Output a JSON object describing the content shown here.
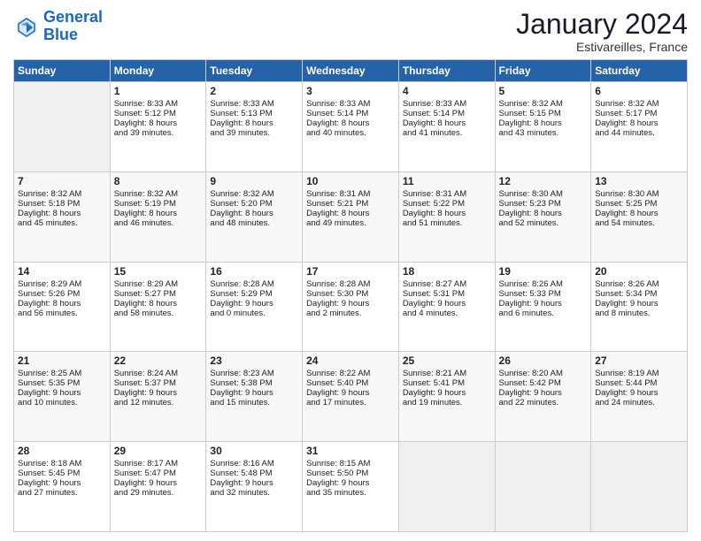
{
  "logo": {
    "line1": "General",
    "line2": "Blue"
  },
  "header": {
    "month": "January 2024",
    "location": "Estivareilles, France"
  },
  "columns": [
    "Sunday",
    "Monday",
    "Tuesday",
    "Wednesday",
    "Thursday",
    "Friday",
    "Saturday"
  ],
  "weeks": [
    [
      {
        "day": "",
        "content": ""
      },
      {
        "day": "1",
        "content": "Sunrise: 8:33 AM\nSunset: 5:12 PM\nDaylight: 8 hours\nand 39 minutes."
      },
      {
        "day": "2",
        "content": "Sunrise: 8:33 AM\nSunset: 5:13 PM\nDaylight: 8 hours\nand 39 minutes."
      },
      {
        "day": "3",
        "content": "Sunrise: 8:33 AM\nSunset: 5:14 PM\nDaylight: 8 hours\nand 40 minutes."
      },
      {
        "day": "4",
        "content": "Sunrise: 8:33 AM\nSunset: 5:14 PM\nDaylight: 8 hours\nand 41 minutes."
      },
      {
        "day": "5",
        "content": "Sunrise: 8:32 AM\nSunset: 5:15 PM\nDaylight: 8 hours\nand 43 minutes."
      },
      {
        "day": "6",
        "content": "Sunrise: 8:32 AM\nSunset: 5:17 PM\nDaylight: 8 hours\nand 44 minutes."
      }
    ],
    [
      {
        "day": "7",
        "content": "Sunrise: 8:32 AM\nSunset: 5:18 PM\nDaylight: 8 hours\nand 45 minutes."
      },
      {
        "day": "8",
        "content": "Sunrise: 8:32 AM\nSunset: 5:19 PM\nDaylight: 8 hours\nand 46 minutes."
      },
      {
        "day": "9",
        "content": "Sunrise: 8:32 AM\nSunset: 5:20 PM\nDaylight: 8 hours\nand 48 minutes."
      },
      {
        "day": "10",
        "content": "Sunrise: 8:31 AM\nSunset: 5:21 PM\nDaylight: 8 hours\nand 49 minutes."
      },
      {
        "day": "11",
        "content": "Sunrise: 8:31 AM\nSunset: 5:22 PM\nDaylight: 8 hours\nand 51 minutes."
      },
      {
        "day": "12",
        "content": "Sunrise: 8:30 AM\nSunset: 5:23 PM\nDaylight: 8 hours\nand 52 minutes."
      },
      {
        "day": "13",
        "content": "Sunrise: 8:30 AM\nSunset: 5:25 PM\nDaylight: 8 hours\nand 54 minutes."
      }
    ],
    [
      {
        "day": "14",
        "content": "Sunrise: 8:29 AM\nSunset: 5:26 PM\nDaylight: 8 hours\nand 56 minutes."
      },
      {
        "day": "15",
        "content": "Sunrise: 8:29 AM\nSunset: 5:27 PM\nDaylight: 8 hours\nand 58 minutes."
      },
      {
        "day": "16",
        "content": "Sunrise: 8:28 AM\nSunset: 5:29 PM\nDaylight: 9 hours\nand 0 minutes."
      },
      {
        "day": "17",
        "content": "Sunrise: 8:28 AM\nSunset: 5:30 PM\nDaylight: 9 hours\nand 2 minutes."
      },
      {
        "day": "18",
        "content": "Sunrise: 8:27 AM\nSunset: 5:31 PM\nDaylight: 9 hours\nand 4 minutes."
      },
      {
        "day": "19",
        "content": "Sunrise: 8:26 AM\nSunset: 5:33 PM\nDaylight: 9 hours\nand 6 minutes."
      },
      {
        "day": "20",
        "content": "Sunrise: 8:26 AM\nSunset: 5:34 PM\nDaylight: 9 hours\nand 8 minutes."
      }
    ],
    [
      {
        "day": "21",
        "content": "Sunrise: 8:25 AM\nSunset: 5:35 PM\nDaylight: 9 hours\nand 10 minutes."
      },
      {
        "day": "22",
        "content": "Sunrise: 8:24 AM\nSunset: 5:37 PM\nDaylight: 9 hours\nand 12 minutes."
      },
      {
        "day": "23",
        "content": "Sunrise: 8:23 AM\nSunset: 5:38 PM\nDaylight: 9 hours\nand 15 minutes."
      },
      {
        "day": "24",
        "content": "Sunrise: 8:22 AM\nSunset: 5:40 PM\nDaylight: 9 hours\nand 17 minutes."
      },
      {
        "day": "25",
        "content": "Sunrise: 8:21 AM\nSunset: 5:41 PM\nDaylight: 9 hours\nand 19 minutes."
      },
      {
        "day": "26",
        "content": "Sunrise: 8:20 AM\nSunset: 5:42 PM\nDaylight: 9 hours\nand 22 minutes."
      },
      {
        "day": "27",
        "content": "Sunrise: 8:19 AM\nSunset: 5:44 PM\nDaylight: 9 hours\nand 24 minutes."
      }
    ],
    [
      {
        "day": "28",
        "content": "Sunrise: 8:18 AM\nSunset: 5:45 PM\nDaylight: 9 hours\nand 27 minutes."
      },
      {
        "day": "29",
        "content": "Sunrise: 8:17 AM\nSunset: 5:47 PM\nDaylight: 9 hours\nand 29 minutes."
      },
      {
        "day": "30",
        "content": "Sunrise: 8:16 AM\nSunset: 5:48 PM\nDaylight: 9 hours\nand 32 minutes."
      },
      {
        "day": "31",
        "content": "Sunrise: 8:15 AM\nSunset: 5:50 PM\nDaylight: 9 hours\nand 35 minutes."
      },
      {
        "day": "",
        "content": ""
      },
      {
        "day": "",
        "content": ""
      },
      {
        "day": "",
        "content": ""
      }
    ]
  ]
}
